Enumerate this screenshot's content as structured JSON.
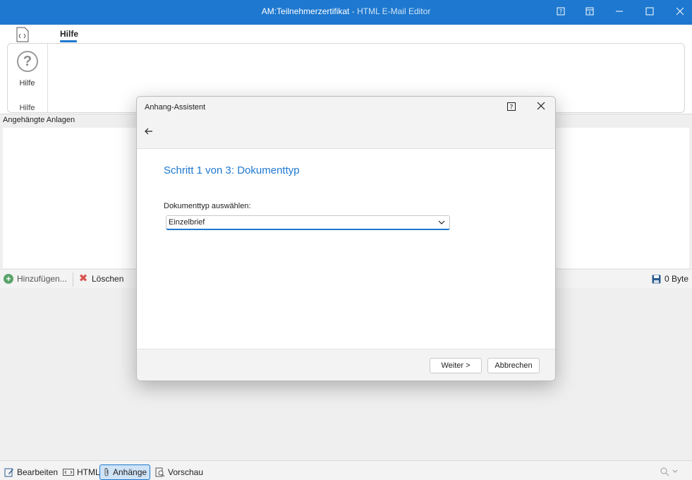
{
  "window": {
    "title_main": "AM:Teilnehmerzertifikat",
    "title_sub": " - HTML E-Mail Editor"
  },
  "ribbon": {
    "tab_hilfe": "Hilfe",
    "help_button_label": "Hilfe",
    "group_label": "Hilfe"
  },
  "attachments": {
    "header": "Angehängte Anlagen",
    "add_label": "Hinzufügen...",
    "delete_label": "Löschen",
    "size": "0 Byte"
  },
  "statusbar": {
    "edit_label": "Bearbeiten",
    "html_label": "HTML",
    "attachments_label": "Anhänge",
    "preview_label": "Vorschau"
  },
  "dialog": {
    "title": "Anhang-Assistent",
    "step_title": "Schritt 1 von 3: Dokumenttyp",
    "field_label": "Dokumenttyp auswählen:",
    "selected_value": "Einzelbrief",
    "next_label": "Weiter >",
    "cancel_label": "Abbrechen"
  },
  "colors": {
    "accent": "#1e78cf",
    "titlebar": "#1e78cf"
  }
}
